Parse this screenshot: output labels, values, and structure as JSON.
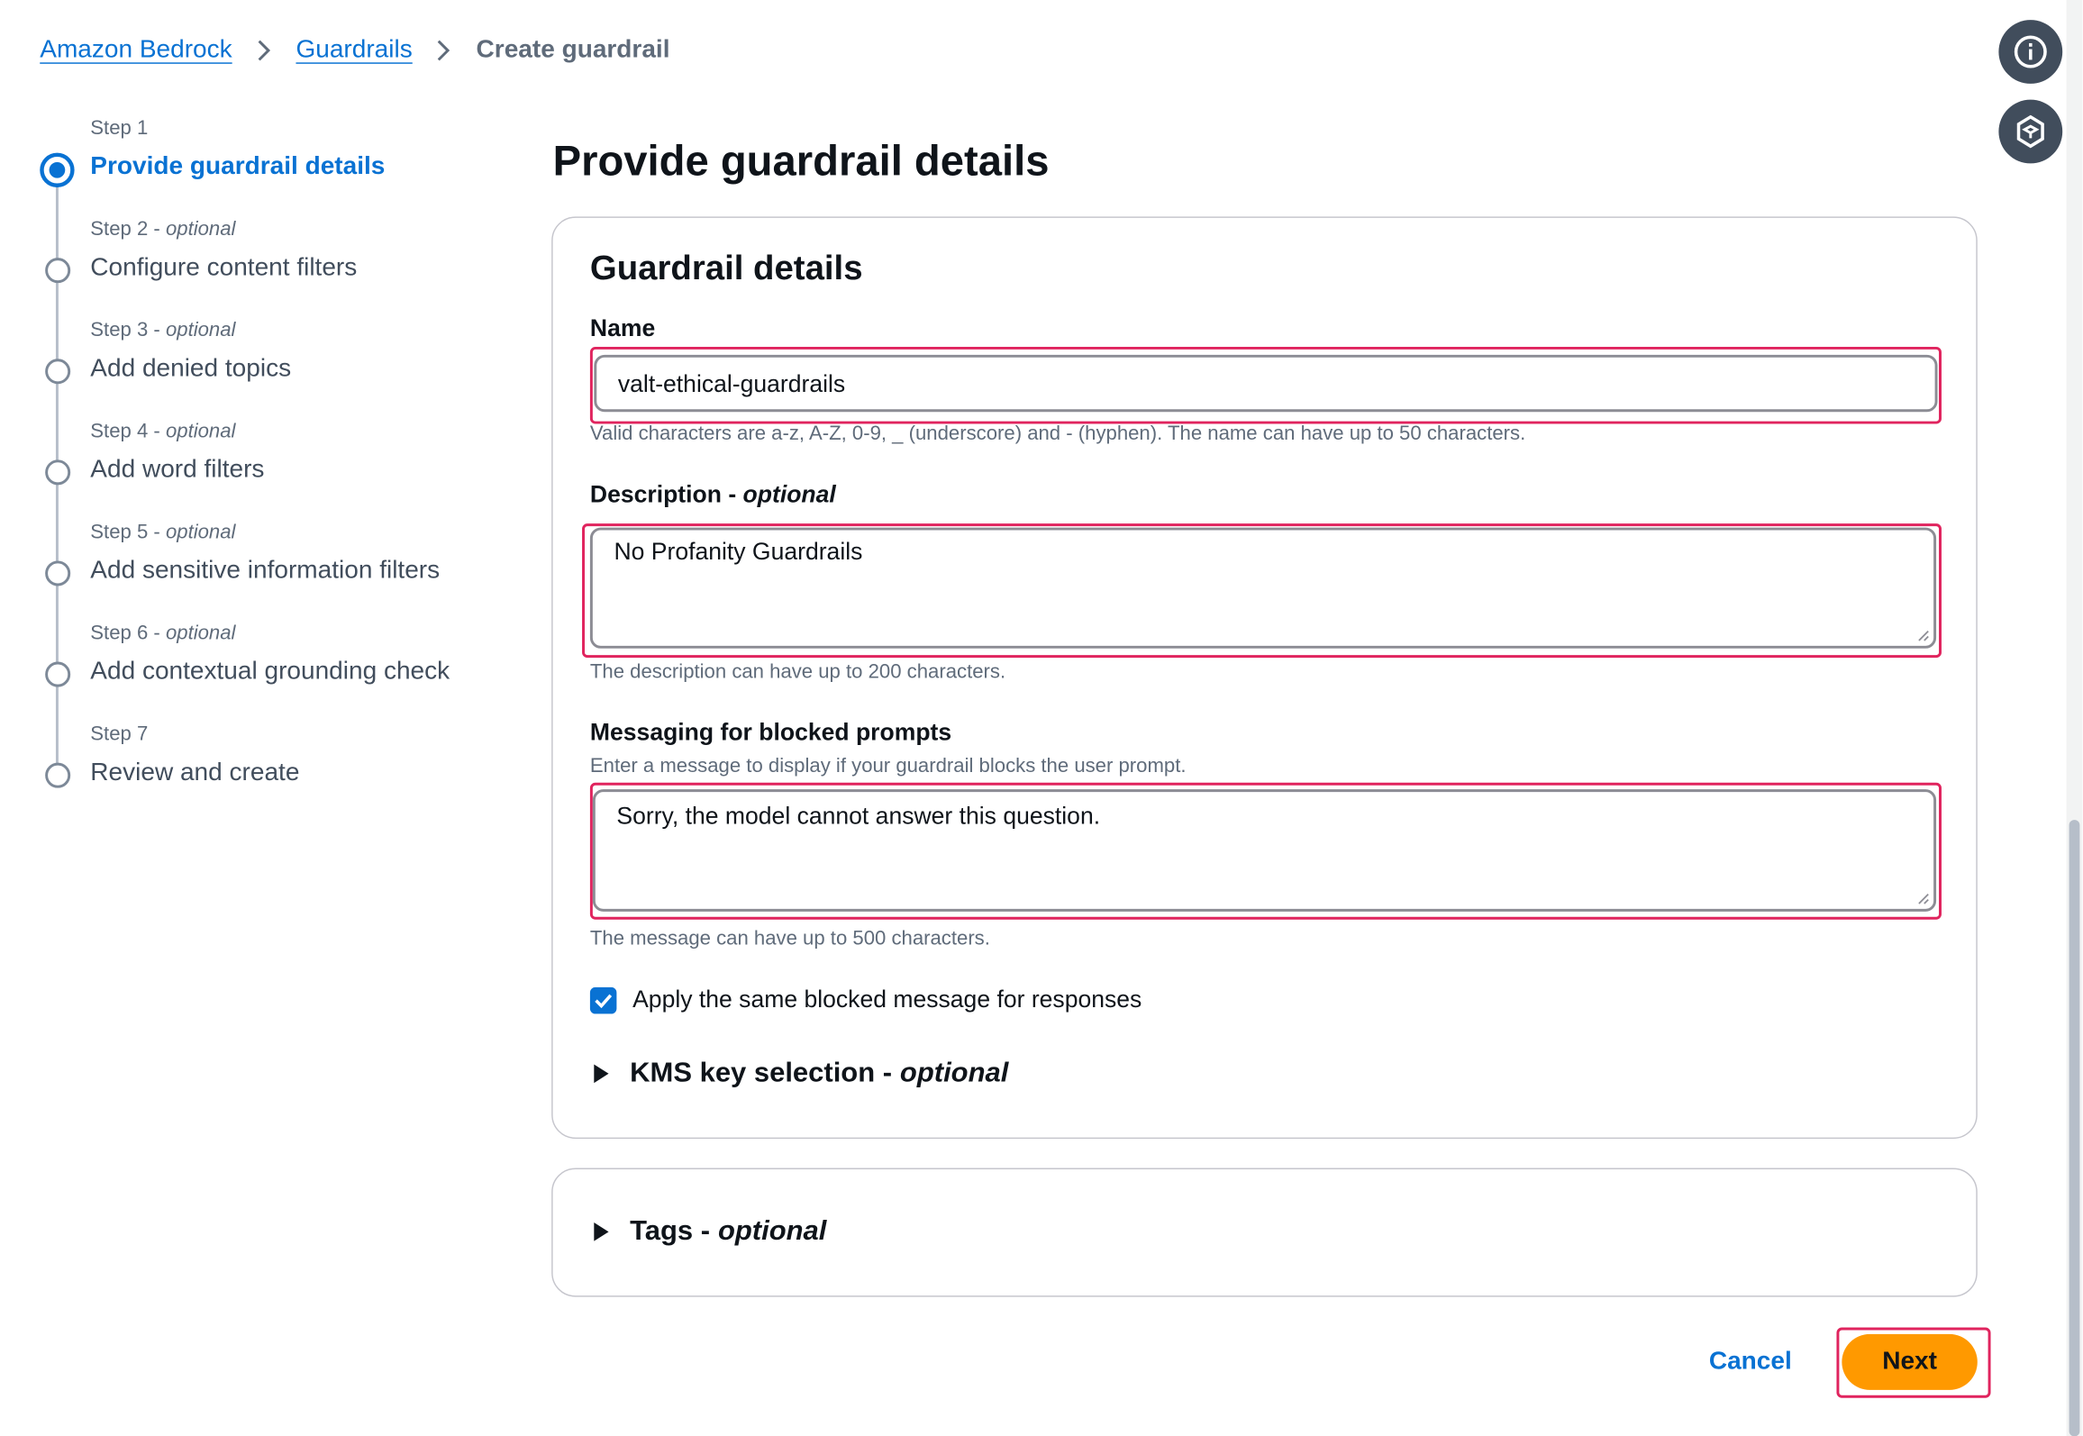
{
  "breadcrumb": {
    "items": [
      "Amazon Bedrock",
      "Guardrails"
    ],
    "current": "Create guardrail"
  },
  "floating": {
    "info_icon": "info-icon",
    "security_icon": "shield-hexagon-icon"
  },
  "steps": [
    {
      "number": "Step 1",
      "optional": "",
      "title": "Provide guardrail details",
      "active": true
    },
    {
      "number": "Step 2",
      "optional": "optional",
      "title": "Configure content filters",
      "active": false
    },
    {
      "number": "Step 3",
      "optional": "optional",
      "title": "Add denied topics",
      "active": false
    },
    {
      "number": "Step 4",
      "optional": "optional",
      "title": "Add word filters",
      "active": false
    },
    {
      "number": "Step 5",
      "optional": "optional",
      "title": "Add sensitive information filters",
      "active": false
    },
    {
      "number": "Step 6",
      "optional": "optional",
      "title": "Add contextual grounding check",
      "active": false
    },
    {
      "number": "Step 7",
      "optional": "",
      "title": "Review and create",
      "active": false
    }
  ],
  "step_separator": " - ",
  "page_title": "Provide guardrail details",
  "details": {
    "title": "Guardrail details",
    "name": {
      "label": "Name",
      "value": "valt-ethical-guardrails",
      "hint": "Valid characters are a-z, A-Z, 0-9, _ (underscore) and - (hyphen). The name can have up to 50 characters."
    },
    "description": {
      "label": "Description - ",
      "label_optional": "optional",
      "value": "No Profanity Guardrails",
      "hint": "The description can have up to 200 characters."
    },
    "blocked": {
      "label": "Messaging for blocked prompts",
      "sub": "Enter a message to display if your guardrail blocks the user prompt.",
      "value": "Sorry, the model cannot answer this question.",
      "hint": "The message can have up to 500 characters."
    },
    "checkbox": {
      "label": "Apply the same blocked message for responses",
      "checked": true
    },
    "kms": {
      "label": "KMS key selection - ",
      "optional": "optional"
    }
  },
  "tags": {
    "label": "Tags - ",
    "optional": "optional"
  },
  "actions": {
    "cancel": "Cancel",
    "next": "Next"
  },
  "colors": {
    "link": "#0972d3",
    "primary": "#ff9900",
    "highlight": "#e0245e"
  }
}
